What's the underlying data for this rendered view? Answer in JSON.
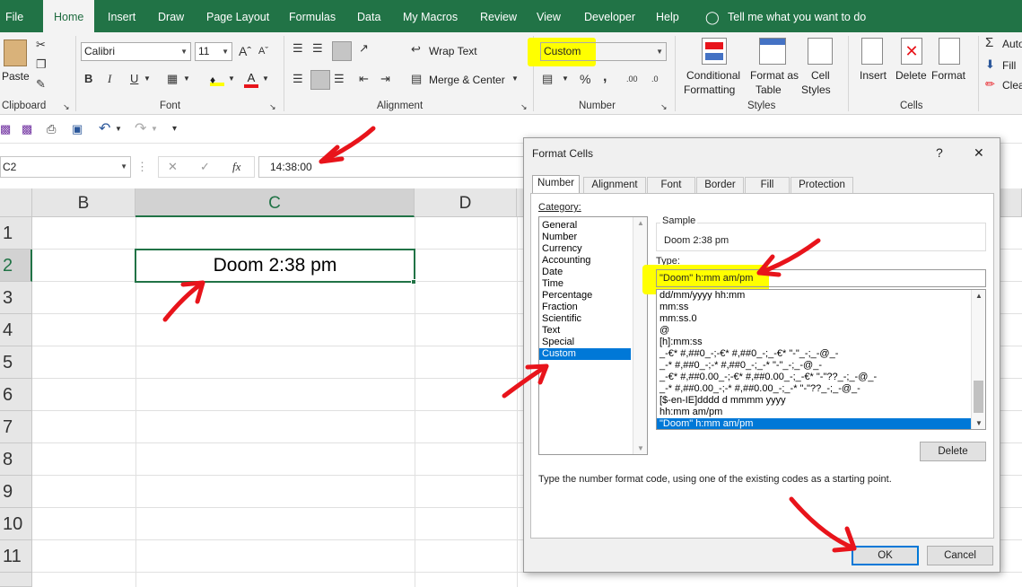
{
  "ribbon_tabs": [
    "File",
    "Home",
    "Insert",
    "Draw",
    "Page Layout",
    "Formulas",
    "Data",
    "My Macros",
    "Review",
    "View",
    "Developer",
    "Help"
  ],
  "tell_me": "Tell me what you want to do",
  "clipboard": {
    "paste": "Paste",
    "group": "Clipboard"
  },
  "font": {
    "name": "Calibri",
    "size": "11",
    "bold": "B",
    "italic": "I",
    "underline": "U",
    "group": "Font"
  },
  "alignment": {
    "wrap": "Wrap Text",
    "merge": "Merge & Center",
    "group": "Alignment"
  },
  "number": {
    "format": "Custom",
    "percent": "%",
    "comma": ",",
    "group": "Number"
  },
  "styles": {
    "conditional_1": "Conditional",
    "conditional_2": "Formatting",
    "format_as_1": "Format as",
    "format_as_2": "Table",
    "cell_1": "Cell",
    "cell_2": "Styles",
    "group": "Styles"
  },
  "cells": {
    "insert": "Insert",
    "delete": "Delete",
    "format": "Format",
    "group": "Cells"
  },
  "editing": {
    "autosum": "Auto",
    "fill": "Fill",
    "clear": "Clea"
  },
  "name_box": "C2",
  "fx": "fx",
  "formula_value": "14:38:00",
  "columns": [
    "B",
    "C",
    "D"
  ],
  "rows": [
    "1",
    "2",
    "3",
    "4",
    "5",
    "6",
    "7",
    "8",
    "9",
    "10",
    "11"
  ],
  "cell_c2": "Doom 2:38 pm",
  "dialog": {
    "title": "Format Cells",
    "help": "?",
    "close": "✕",
    "tabs": [
      "Number",
      "Alignment",
      "Font",
      "Border",
      "Fill",
      "Protection"
    ],
    "category_label": "Category:",
    "categories": [
      "General",
      "Number",
      "Currency",
      "Accounting",
      "Date",
      "Time",
      "Percentage",
      "Fraction",
      "Scientific",
      "Text",
      "Special",
      "Custom"
    ],
    "selected_category": "Custom",
    "sample_label": "Sample",
    "sample_value": "Doom 2:38 pm",
    "type_label": "Type:",
    "type_value": "\"Doom\" h:mm am/pm",
    "type_list": [
      "dd/mm/yyyy hh:mm",
      "mm:ss",
      "mm:ss.0",
      "@",
      "[h]:mm:ss",
      "_-€* #,##0_-;-€* #,##0_-;_-€* \"-\"_-;_-@_-",
      "_-* #,##0_-;-* #,##0_-;_-* \"-\"_-;_-@_-",
      "_-€* #,##0.00_-;-€* #,##0.00_-;_-€* \"-\"??_-;_-@_-",
      "_-* #,##0.00_-;-* #,##0.00_-;_-* \"-\"??_-;_-@_-",
      "[$-en-IE]dddd d mmmm yyyy",
      "hh:mm am/pm",
      "\"Doom\" h:mm am/pm"
    ],
    "delete": "Delete",
    "description": "Type the number format code, using one of the existing codes as a starting point.",
    "ok": "OK",
    "cancel": "Cancel"
  },
  "colors": {
    "accent": "#217346",
    "highlight": "#ffff00",
    "arrow": "#e8141b",
    "selection": "#0078d7"
  }
}
